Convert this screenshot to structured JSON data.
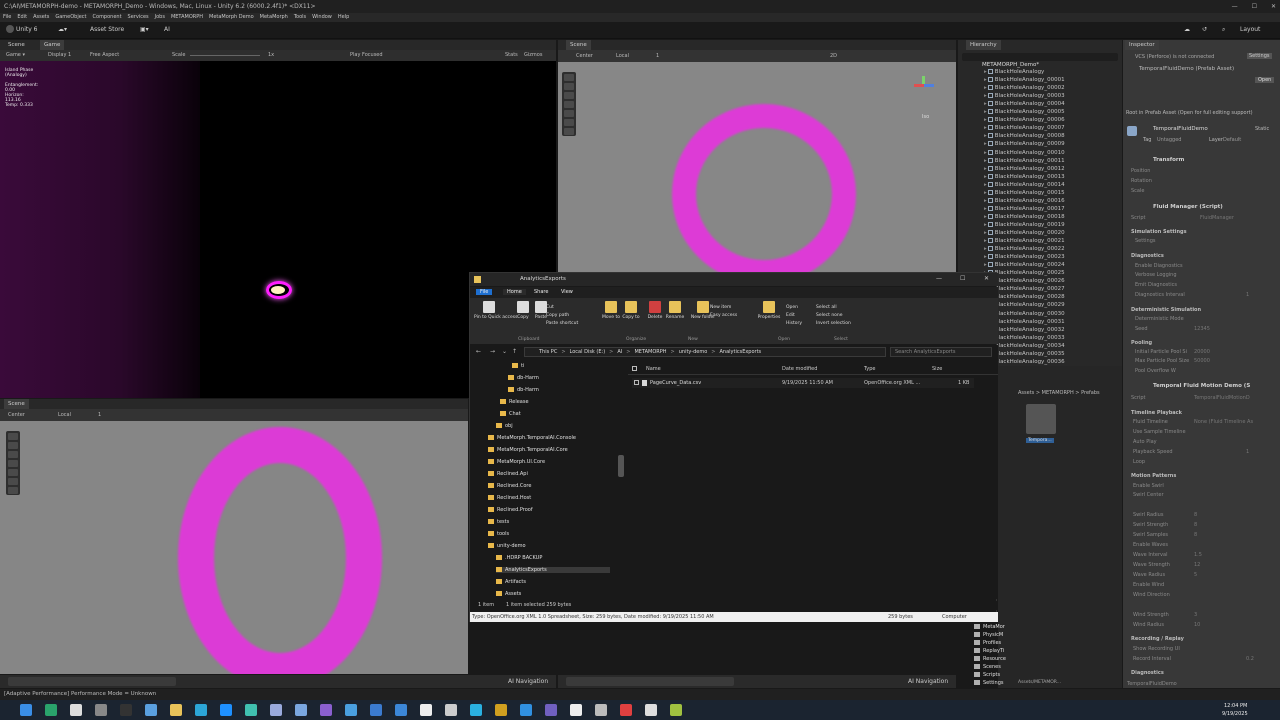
{
  "window": {
    "title": "C:\\AI\\METAMORPH-demo - METAMORPH_Demo - Windows, Mac, Linux - Unity 6.2 (6000.2.4f1)* <DX11>"
  },
  "menu": [
    "File",
    "Edit",
    "Assets",
    "GameObject",
    "Component",
    "Services",
    "Jobs",
    "METAMORPH",
    "MetaMorph Demo",
    "MetaMorph",
    "Tools",
    "Window",
    "Help"
  ],
  "toolbar": {
    "account": "Unity 6",
    "asset_store": "Asset Store",
    "ai": "AI",
    "layout": "Layout"
  },
  "game_panel": {
    "tab_scene": "Scene",
    "tab_game": "Game",
    "display": "Display 1",
    "aspect": "Free Aspect",
    "scale": "Scale",
    "scale_val": "1x",
    "play_focused": "Play Focused",
    "stats": "Stats",
    "gizmos": "Gizmos",
    "overlay": [
      "Island Phase",
      "(Analogy)",
      "",
      "Entanglement:",
      "0.00",
      "Horizon:",
      "113.16",
      "Temp: 0.333"
    ]
  },
  "scene_top": {
    "tab": "Scene",
    "center": "Center",
    "local": "Local",
    "grid_val": "1",
    "mode": "2D",
    "persp": "Iso"
  },
  "scene_bottom": {
    "tab": "Scene",
    "center": "Center",
    "local": "Local",
    "grid_val": "1",
    "ai_nav": "AI Navigation"
  },
  "scene_top_ainav": "AI Navigation",
  "hierarchy": {
    "title": "Hierarchy",
    "root": "METAMORPH_Demo*",
    "items": [
      "BlackHoleAnalogy",
      "BlackHoleAnalogy_00001",
      "BlackHoleAnalogy_00002",
      "BlackHoleAnalogy_00003",
      "BlackHoleAnalogy_00004",
      "BlackHoleAnalogy_00005",
      "BlackHoleAnalogy_00006",
      "BlackHoleAnalogy_00007",
      "BlackHoleAnalogy_00008",
      "BlackHoleAnalogy_00009",
      "BlackHoleAnalogy_00010",
      "BlackHoleAnalogy_00011",
      "BlackHoleAnalogy_00012",
      "BlackHoleAnalogy_00013",
      "BlackHoleAnalogy_00014",
      "BlackHoleAnalogy_00015",
      "BlackHoleAnalogy_00016",
      "BlackHoleAnalogy_00017",
      "BlackHoleAnalogy_00018",
      "BlackHoleAnalogy_00019",
      "BlackHoleAnalogy_00020",
      "BlackHoleAnalogy_00021",
      "BlackHoleAnalogy_00022",
      "BlackHoleAnalogy_00023",
      "BlackHoleAnalogy_00024",
      "BlackHoleAnalogy_00025",
      "BlackHoleAnalogy_00026",
      "BlackHoleAnalogy_00027",
      "BlackHoleAnalogy_00028",
      "BlackHoleAnalogy_00029",
      "BlackHoleAnalogy_00030",
      "BlackHoleAnalogy_00031",
      "BlackHoleAnalogy_00032",
      "BlackHoleAnalogy_00033",
      "BlackHoleAnalogy_00034",
      "BlackHoleAnalogy_00035",
      "BlackHoleAnalogy_00036",
      "BlackHoleAnalogy_00037"
    ]
  },
  "project": {
    "breadcrumb": "Assets > METAMORPH > Prefabs",
    "asset": "Tempora...",
    "folders": [
      "MetaMor",
      "PhysicM",
      "Profiles",
      "ReplayTi",
      "Resource",
      "Scenes",
      "Scripts",
      "Settings"
    ],
    "path": "Assets/METAMOR..."
  },
  "inspector": {
    "title": "Inspector",
    "vcs": "VCS (Perforce) is not connected",
    "settings": "Settings",
    "prefab_asset": "TemporalFluidDemo (Prefab Asset)",
    "open": "Open",
    "root_note": "Root in Prefab Asset (Open for full editing support)",
    "name": "TemporalFluidDemo",
    "static": "Static",
    "tag": "Tag",
    "tag_val": "Untagged",
    "layer": "Layer",
    "layer_val": "Default",
    "transform": "Transform",
    "position": "Position",
    "rotation": "Rotation",
    "scale": "Scale",
    "fluid_manager": "Fluid Manager (Script)",
    "script": "Script",
    "script_val": "FluidManager",
    "sim_settings": "Simulation Settings",
    "settings_lbl": "Settings",
    "diagnostics": "Diagnostics",
    "enable_diag": "Enable Diagnostics",
    "verbose": "Verbose Logging",
    "emit_diag": "Emit Diagnostics",
    "diag_interval": "Diagnostics Interval",
    "diag_interval_val": "1",
    "det_sim": "Deterministic Simulation",
    "det_mode": "Deterministic Mode",
    "seed": "Seed",
    "seed_val": "12345",
    "pooling": "Pooling",
    "init_pool": "Initial Particle Pool Si",
    "init_pool_val": "20000",
    "max_pool": "Max Particle Pool Size",
    "max_pool_val": "50000",
    "pool_overflow": "Pool Overflow W",
    "motion_demo": "Temporal Fluid Motion Demo (S",
    "script_val2": "TemporalFluidMotionD",
    "timeline": "Timeline Playback",
    "fluid_timeline": "Fluid Timeline",
    "fluid_timeline_val": "None (Fluid Timeline As",
    "use_sample": "Use Sample Timeline",
    "auto_play": "Auto Play",
    "playback_speed": "Playback Speed",
    "playback_speed_val": "1",
    "loop": "Loop",
    "motion_patterns": "Motion Patterns",
    "enable_swirl": "Enable Swirl",
    "swirl_center": "Swirl Center",
    "swirl_radius": "Swirl Radius",
    "swirl_radius_val": "8",
    "swirl_strength": "Swirl Strength",
    "swirl_strength_val": "8",
    "swirl_samples": "Swirl Samples",
    "swirl_samples_val": "8",
    "enable_waves": "Enable Waves",
    "wave_interval": "Wave Interval",
    "wave_interval_val": "1.5",
    "wave_strength": "Wave Strength",
    "wave_strength_val": "12",
    "wave_radius": "Wave Radius",
    "wave_radius_val": "5",
    "enable_wind": "Enable Wind",
    "wind_direction": "Wind Direction",
    "wind_strength": "Wind Strength",
    "wind_strength_val": "3",
    "wind_radius": "Wind Radius",
    "wind_radius_val": "10",
    "recording": "Recording / Replay",
    "show_recording": "Show Recording UI",
    "record_interval": "Record Interval",
    "record_interval_val": "0.2",
    "diagnostics2": "Diagnostics",
    "footer": "TemporalFluidDemo"
  },
  "explorer": {
    "title": "AnalyticsExports",
    "tabs": [
      "File",
      "Home",
      "Share",
      "View"
    ],
    "ribbon": {
      "pin": "Pin to Quick access",
      "copy": "Copy",
      "paste": "Paste",
      "cut": "Cut",
      "copy_path": "Copy path",
      "paste_shortcut": "Paste shortcut",
      "move_to": "Move to",
      "copy_to": "Copy to",
      "delete": "Delete",
      "rename": "Rename",
      "new_folder": "New folder",
      "new_item": "New item",
      "easy_access": "Easy access",
      "properties": "Properties",
      "open": "Open",
      "edit": "Edit",
      "history": "History",
      "select_all": "Select all",
      "select_none": "Select none",
      "invert": "Invert selection",
      "groups": [
        "Clipboard",
        "Organize",
        "New",
        "Open",
        "Select"
      ]
    },
    "address": [
      "This PC",
      "Local Disk (E:)",
      "AI",
      "METAMORPH",
      "unity-demo",
      "AnalyticsExports"
    ],
    "search_placeholder": "Search AnalyticsExports",
    "tree": [
      "ti",
      "db-Harm",
      "db-Harm",
      "Release",
      "Chat",
      "obj",
      "MetaMorph.TemporalAI.Console",
      "MetaMorph.TemporalAI.Core",
      "MetaMorph.UI.Core",
      "Reclined.Api",
      "Reclined.Core",
      "Reclined.Host",
      "Reclined.Proof",
      "tests",
      "tools",
      "unity-demo",
      ".HDRP BACKUP",
      "AnalyticsExports",
      "Artifacts",
      "Assets"
    ],
    "columns": [
      "Name",
      "Date modified",
      "Type",
      "Size"
    ],
    "file": {
      "name": "PageCurve_Data.csv",
      "date": "9/19/2025 11:50 AM",
      "type": "OpenOffice.org XML ...",
      "size": "1 KB"
    },
    "status_items": "1 item",
    "status_selected": "1 item selected  259 bytes",
    "details": "Type: OpenOffice.org XML 1.0 Spreadsheet, Size: 259 bytes, Date modified: 9/19/2025 11:50 AM",
    "details_size": "259 bytes",
    "details_computer": "Computer"
  },
  "statusbar": {
    "text": "[Adaptive Performance] Performance Mode = Unknown"
  },
  "taskbar": {
    "time": "12:04 PM",
    "date": "9/19/2025"
  },
  "colors": {
    "particle": "#ff1fff",
    "explorer_bg": "#191919",
    "unity_panel": "#383838"
  }
}
